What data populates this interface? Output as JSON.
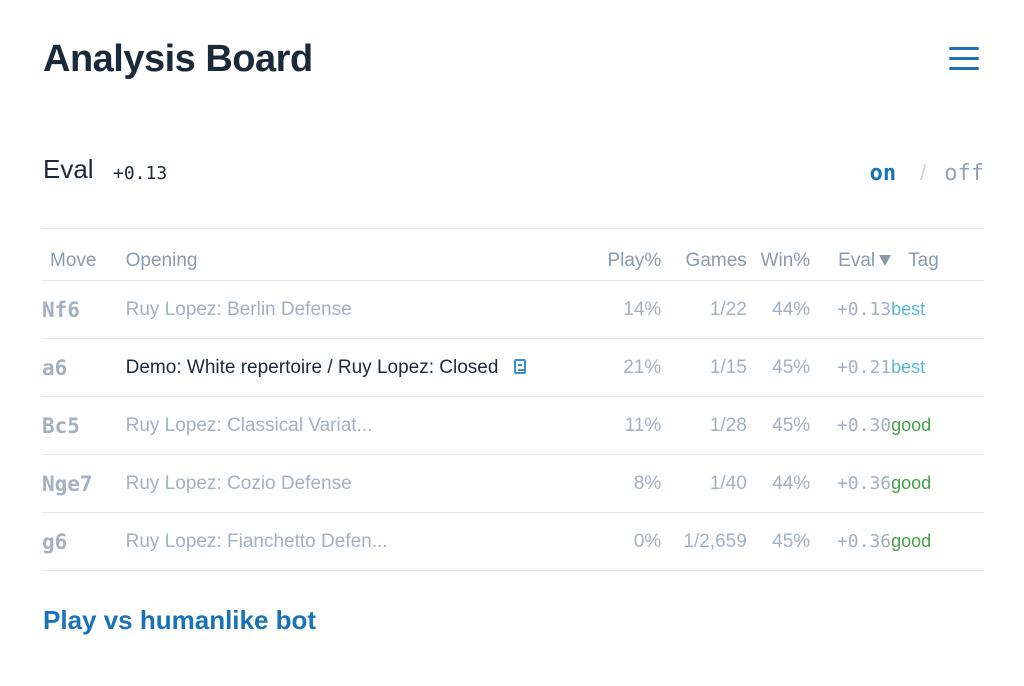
{
  "header": {
    "title": "Analysis Board",
    "menu_icon": "hamburger-menu-icon"
  },
  "eval": {
    "label": "Eval",
    "value": "+0.13",
    "toggle": {
      "on_label": "on",
      "separator": "/",
      "off_label": "off",
      "selected": "on"
    }
  },
  "table": {
    "columns": [
      "Move",
      "Opening",
      "Play%",
      "Games",
      "Win%",
      "Eval",
      "Tag"
    ],
    "sort_column": "Eval",
    "rows": [
      {
        "move": "Nf6",
        "opening": "Ruy Lopez: Berlin Defense",
        "play": "14%",
        "games": "1/22",
        "win": "44%",
        "eval": "+0.13",
        "tag": "best",
        "highlight": false,
        "book": false
      },
      {
        "move": "a6",
        "opening": "Demo: White repertoire / Ruy Lopez: Closed",
        "play": "21%",
        "games": "1/15",
        "win": "45%",
        "eval": "+0.21",
        "tag": "best",
        "highlight": true,
        "book": true
      },
      {
        "move": "Bc5",
        "opening": "Ruy Lopez: Classical Variat...",
        "play": "11%",
        "games": "1/28",
        "win": "45%",
        "eval": "+0.30",
        "tag": "good",
        "highlight": false,
        "book": false
      },
      {
        "move": "Nge7",
        "opening": "Ruy Lopez: Cozio Defense",
        "play": "8%",
        "games": "1/40",
        "win": "44%",
        "eval": "+0.36",
        "tag": "good",
        "highlight": false,
        "book": false
      },
      {
        "move": "g6",
        "opening": "Ruy Lopez: Fianchetto Defen...",
        "play": "0%",
        "games": "1/2,659",
        "win": "45%",
        "eval": "+0.36",
        "tag": "good",
        "highlight": false,
        "book": false
      }
    ]
  },
  "bot_link": {
    "label": "Play vs humanlike bot"
  },
  "colors": {
    "accent": "#1a73b8",
    "tag_best": "#56b6d8",
    "tag_good": "#43a047",
    "muted_text": "#a3b1c2",
    "title_text": "#1b2a3a"
  }
}
